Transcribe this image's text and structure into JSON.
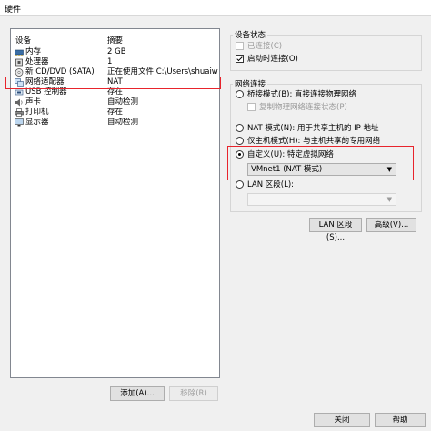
{
  "window": {
    "title": "硬件"
  },
  "device_list": {
    "col_device": "设备",
    "col_summary": "摘要",
    "items": [
      {
        "name": "内存",
        "summary": "2 GB",
        "icon": "memory-icon"
      },
      {
        "name": "处理器",
        "summary": "1",
        "icon": "processor-icon"
      },
      {
        "name": "新 CD/DVD (SATA)",
        "summary": "正在使用文件 C:\\Users\\shuaiwa...",
        "icon": "cd-dvd-icon"
      },
      {
        "name": "网络适配器",
        "summary": "NAT",
        "icon": "network-adapter-icon"
      },
      {
        "name": "USB 控制器",
        "summary": "存在",
        "icon": "usb-icon"
      },
      {
        "name": "声卡",
        "summary": "自动检测",
        "icon": "sound-card-icon"
      },
      {
        "name": "打印机",
        "summary": "存在",
        "icon": "printer-icon"
      },
      {
        "name": "显示器",
        "summary": "自动检测",
        "icon": "display-icon"
      }
    ],
    "add_button": "添加(A)...",
    "remove_button": "移除(R)"
  },
  "device_status": {
    "legend": "设备状态",
    "connected": "已连接(C)",
    "connect_at_power_on": "启动时连接(O)"
  },
  "network_connection": {
    "legend": "网络连接",
    "bridged": "桥接模式(B): 直接连接物理网络",
    "replicate_state": "复制物理网络连接状态(P)",
    "nat": "NAT 模式(N): 用于共享主机的 IP 地址",
    "host_only": "仅主机模式(H): 与主机共享的专用网络",
    "custom": "自定义(U): 特定虚拟网络",
    "custom_value": "VMnet1 (NAT 模式)",
    "lan_segment": "LAN 区段(L):",
    "lan_segment_value": "",
    "selected": "custom"
  },
  "buttons": {
    "lan_segments": "LAN 区段(S)...",
    "advanced": "高级(V)...",
    "close": "关闭",
    "help": "帮助"
  },
  "colors": {
    "highlight_box": "#e8242c"
  }
}
